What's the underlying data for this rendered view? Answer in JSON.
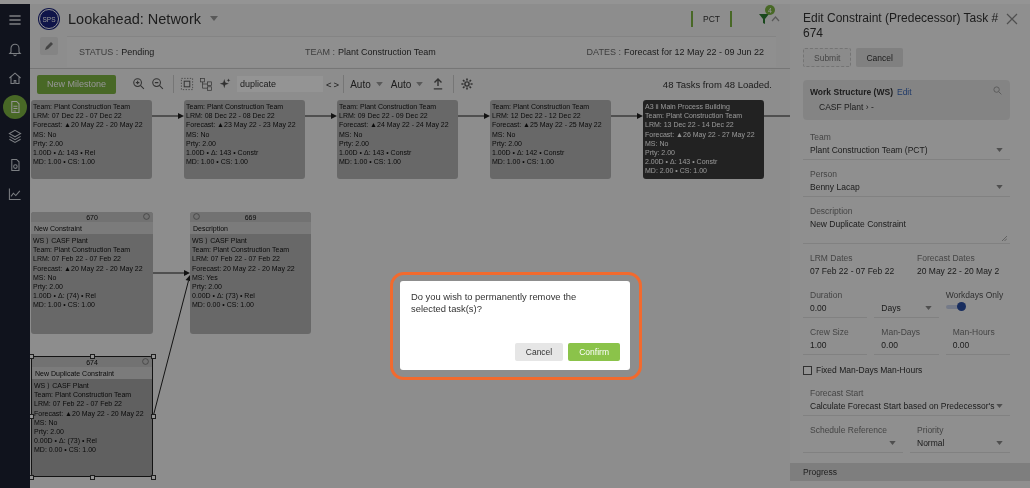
{
  "sidebar": {
    "items": [
      {
        "selected": false
      },
      {
        "selected": false
      },
      {
        "selected": false
      },
      {
        "selected": true
      },
      {
        "selected": false
      },
      {
        "selected": false
      },
      {
        "selected": false
      }
    ]
  },
  "header": {
    "logo": "SPS",
    "title": "Lookahead: Network",
    "team_chip": "PCT",
    "filter_badge": "4"
  },
  "info": {
    "status_label": "STATUS :",
    "status": "Pending",
    "team_label": "TEAM :",
    "team": "Plant Construction Team",
    "dates_label": "DATES :",
    "dates": "Forecast for 12 May 22 - 09 Jun 22"
  },
  "toolbar": {
    "new_button": "New Milestone",
    "search": {
      "value": "duplicate"
    },
    "prev": "<",
    "next": ">",
    "dropdowns": [
      "Auto",
      "Auto"
    ],
    "summary": "48 Tasks from 48 Loaded."
  },
  "canvas": {
    "nodes": [
      {
        "selected": false,
        "highlighted": false,
        "lines": [
          "Team: Plant Construction Team",
          "LRM: 07 Dec 22 - 07 Dec 22",
          "Forecast: ▲20 May 22 - 20 May 22",
          "MS: No",
          "Prty: 2.00",
          "1.00D • Δ: 143 • Rel",
          "MD: 1.00 • CS: 1.00"
        ]
      },
      {
        "selected": false,
        "highlighted": false,
        "lines": [
          "Team: Plant Construction Team",
          "LRM: 08 Dec 22 - 08 Dec 22",
          "Forecast: ▲23 May 22 - 23 May 22",
          "MS: No",
          "Prty: 2.00",
          "1.00D • Δ: 143 • Constr",
          "MD: 1.00 • CS: 1.00"
        ]
      },
      {
        "selected": false,
        "highlighted": false,
        "lines": [
          "Team: Plant Construction Team",
          "LRM: 09 Dec 22 - 09 Dec 22",
          "Forecast: ▲24 May 22 - 24 May 22",
          "MS: No",
          "Prty: 2.00",
          "1.00D • Δ: 143 • Constr",
          "MD: 1.00 • CS: 1.00"
        ]
      },
      {
        "selected": false,
        "highlighted": false,
        "lines": [
          "Team: Plant Construction Team",
          "LRM: 12 Dec 22 - 12 Dec 22",
          "Forecast: ▲25 May 22 - 25 May 22",
          "MS: No",
          "Prty: 2.00",
          "1.00D • Δ: 142 • Constr",
          "MD: 1.00 • CS: 1.00"
        ]
      },
      {
        "selected": false,
        "highlighted": true,
        "lines": [
          "A3 ii Main Process Building",
          "Team: Plant Construction Team",
          "LRM: 13 Dec 22 - 14 Dec 22",
          "Forecast: ▲26 May 22 - 27 May 22",
          "MS: No",
          "Prty: 2.00",
          "2.00D • Δ: 143 • Constr",
          "MD: 2.00 • CS: 1.00"
        ]
      },
      {
        "selected": false,
        "highlighted": false,
        "kind": "task",
        "header": "670",
        "title": "New Constraint",
        "lines": [
          "WS ⟩ CASF Plant",
          "Team: Plant Construction Team",
          "LRM: 07 Feb 22 - 07 Feb 22",
          "Forecast: ▲20 May 22 - 20 May 22",
          "MS: No",
          "Prty: 2.00",
          "1.00D • Δ: (74) • Rel",
          "MD: 1.00 • CS: 1.00"
        ]
      },
      {
        "selected": false,
        "highlighted": false,
        "kind": "milestone",
        "header": "669",
        "title": "Description",
        "lines": [
          "WS ⟩ CASF Plant",
          "Team: Plant Construction Team",
          "LRM: 07 Feb 22 - 07 Feb 22",
          "Forecast: 20 May 22 - 20 May 22",
          "MS: Yes",
          "Prty: 2.00",
          "0.00D • Δ: (73) • Rel",
          "MD: 0.00 • CS: 1.00"
        ]
      },
      {
        "selected": true,
        "highlighted": false,
        "kind": "task",
        "header": "674",
        "title": "New Duplicate Constraint",
        "lines": [
          "WS ⟩ CASF Plant",
          "Team: Plant Construction Team",
          "LRM: 07 Feb 22 - 07 Feb 22",
          "Forecast: ▲20 May 22 - 20 May 22",
          "MS: No",
          "Prty: 2.00",
          "0.00D • Δ: (73) • Rel",
          "MD: 0.00 • CS: 1.00"
        ]
      }
    ]
  },
  "panel": {
    "title": "Edit Constraint (Predecessor) Task # 674",
    "buttons": [
      {
        "label": "Submit",
        "disabled": true
      },
      {
        "label": "Cancel",
        "disabled": false
      }
    ],
    "ws": {
      "label": "Work Structure (WS)",
      "edit": "Edit",
      "path": "CASF Plant › -"
    },
    "rows": [
      {
        "fields": [
          {
            "kind": "select",
            "label": "Team",
            "value": "Plant Construction Team (PCT)"
          }
        ]
      },
      {
        "fields": [
          {
            "kind": "select",
            "label": "Person",
            "value": "Benny Lacap"
          }
        ]
      },
      {
        "fields": [
          {
            "kind": "textarea",
            "label": "Description",
            "value": "New Duplicate Constraint"
          }
        ]
      },
      {
        "fields": [
          {
            "kind": "static",
            "label": "LRM Dates",
            "value": "07 Feb 22 - 07 Feb 22"
          },
          {
            "kind": "static",
            "label": "Forecast Dates",
            "value": "20 May 22 - 20 May 2"
          }
        ]
      },
      {
        "fields": [
          {
            "kind": "text",
            "label": "Duration",
            "value": "0.00"
          },
          {
            "kind": "select",
            "value": "Days"
          },
          {
            "kind": "toggle",
            "label": "Workdays Only",
            "on": true
          }
        ]
      },
      {
        "fields": [
          {
            "kind": "text",
            "label": "Crew Size",
            "value": "1.00"
          },
          {
            "kind": "text",
            "label": "Man-Days",
            "value": "0.00"
          },
          {
            "kind": "text",
            "label": "Man-Hours",
            "value": "0.00"
          }
        ]
      },
      {
        "fields": [
          {
            "kind": "checkbox",
            "label": "Fixed Man-Days Man-Hours",
            "checked": false
          }
        ]
      },
      {
        "fields": [
          {
            "kind": "select",
            "label": "Forecast Start",
            "value": "Calculate Forecast Start based on Predecessor's"
          }
        ]
      },
      {
        "fields": [
          {
            "kind": "select",
            "label": "Schedule Reference"
          },
          {
            "kind": "select",
            "label": "Priority",
            "value": "Normal"
          }
        ]
      }
    ],
    "section": "Progress"
  },
  "dialog": {
    "message": "Do you wish to permanently remove the selected task(s)?",
    "buttons": [
      {
        "label": "Cancel",
        "kind": "secondary"
      },
      {
        "label": "Confirm",
        "kind": "primary"
      }
    ]
  }
}
